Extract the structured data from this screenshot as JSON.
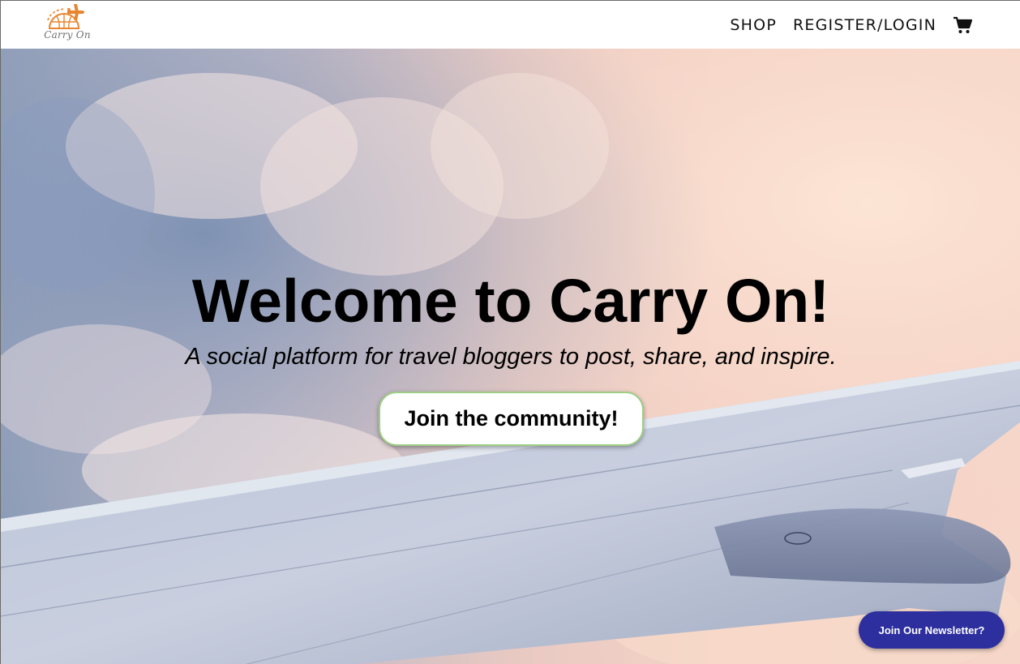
{
  "header": {
    "logo_text": "Carry On",
    "nav": {
      "shop_label": "SHOP",
      "register_login_label": "REGISTER/LOGIN",
      "cart_icon": "shopping-cart-icon"
    }
  },
  "hero": {
    "title": "Welcome to Carry On!",
    "subtitle": "A social platform for travel bloggers to post, share, and inspire.",
    "cta_label": "Join the community!"
  },
  "newsletter": {
    "label": "Join Our Newsletter?"
  },
  "colors": {
    "logo_orange": "#e8852e",
    "newsletter_bg": "#2d2f9e",
    "cta_border": "#9dcf85"
  }
}
